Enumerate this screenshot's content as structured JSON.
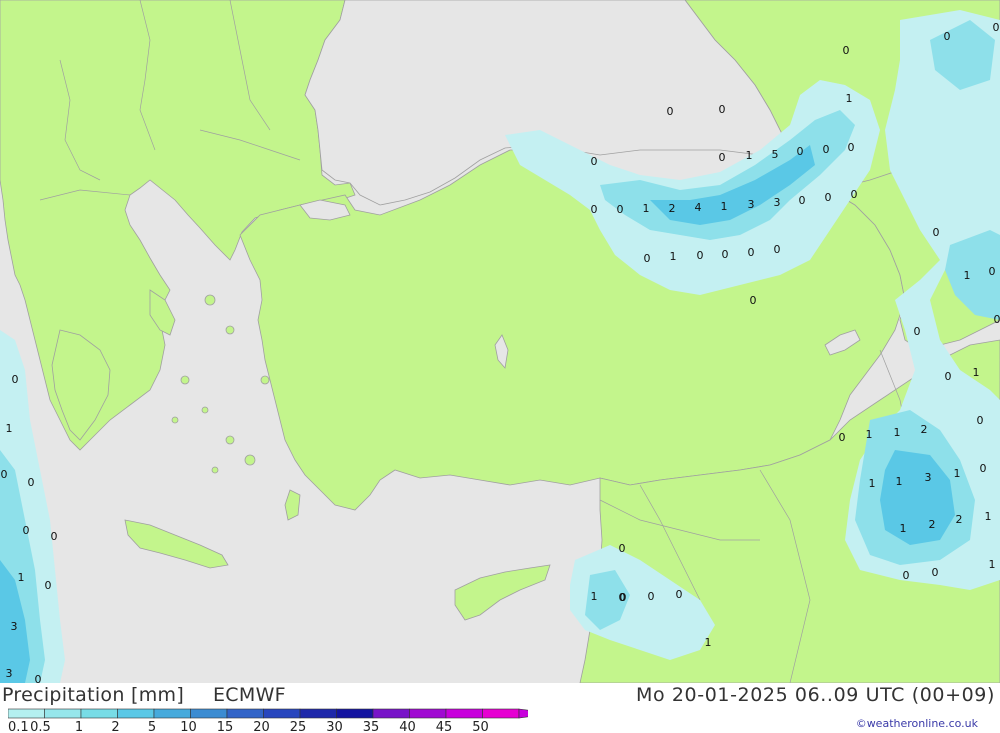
{
  "header": {
    "title": "Precipitation [mm]",
    "model": "ECMWF",
    "valid_time": "Mo 20-01-2025 06..09 UTC (00+09)",
    "credit": "©weatheronline.co.uk"
  },
  "legend": {
    "labels": [
      "0.1",
      "0.5",
      "1",
      "2",
      "5",
      "10",
      "15",
      "20",
      "25",
      "30",
      "35",
      "40",
      "45",
      "50"
    ],
    "colors": [
      "#b4f0f0",
      "#96e6eb",
      "#78dce6",
      "#5ac8e6",
      "#46aadc",
      "#3c8cd2",
      "#3264c8",
      "#2846be",
      "#1e28aa",
      "#1414a0",
      "#7814c8",
      "#a00ad2",
      "#c800dc",
      "#e600d2",
      "#dc00b4",
      "#be00aa"
    ]
  },
  "colors": {
    "land": "#c3f58c",
    "sea": "#e6e6e6",
    "border": "#a0a0a0",
    "precip_light": "#c4f0f2",
    "precip_mid": "#8ee0ea",
    "precip_heavy": "#5ac8e6"
  },
  "map_values": [
    {
      "v": "0"
    },
    {
      "v": "0"
    },
    {
      "v": "0"
    },
    {
      "v": "1"
    },
    {
      "v": "0"
    },
    {
      "v": "0"
    },
    {
      "v": "0"
    },
    {
      "v": "0"
    },
    {
      "v": "1"
    },
    {
      "v": "5"
    },
    {
      "v": "0"
    },
    {
      "v": "0"
    },
    {
      "v": "0"
    },
    {
      "v": "0"
    },
    {
      "v": "0"
    },
    {
      "v": "1"
    },
    {
      "v": "2"
    },
    {
      "v": "4"
    },
    {
      "v": "1"
    },
    {
      "v": "3"
    },
    {
      "v": "3"
    },
    {
      "v": "0"
    },
    {
      "v": "0"
    },
    {
      "v": "0"
    },
    {
      "v": "0"
    },
    {
      "v": "1"
    },
    {
      "v": "0"
    },
    {
      "v": "0"
    },
    {
      "v": "0"
    },
    {
      "v": "0"
    },
    {
      "v": "0"
    },
    {
      "v": "0"
    },
    {
      "v": "0"
    },
    {
      "v": "1"
    },
    {
      "v": "0"
    },
    {
      "v": "0"
    },
    {
      "v": "0"
    },
    {
      "v": "0"
    },
    {
      "v": "1"
    },
    {
      "v": "0"
    },
    {
      "v": "0"
    },
    {
      "v": "1"
    },
    {
      "v": "1"
    },
    {
      "v": "2"
    },
    {
      "v": "1"
    },
    {
      "v": "0"
    },
    {
      "v": "1"
    },
    {
      "v": "1"
    },
    {
      "v": "3"
    },
    {
      "v": "1"
    },
    {
      "v": "0"
    },
    {
      "v": "1"
    },
    {
      "v": "2"
    },
    {
      "v": "2"
    },
    {
      "v": "1"
    },
    {
      "v": "0"
    },
    {
      "v": "0"
    },
    {
      "v": "0"
    },
    {
      "v": "1"
    },
    {
      "v": "0"
    },
    {
      "v": "1"
    },
    {
      "v": "0"
    },
    {
      "v": "0"
    },
    {
      "v": "0"
    },
    {
      "v": "1"
    },
    {
      "v": "0"
    },
    {
      "v": "0"
    },
    {
      "v": "0"
    },
    {
      "v": "1"
    },
    {
      "v": "0"
    },
    {
      "v": "3"
    },
    {
      "v": "3"
    },
    {
      "v": "0"
    }
  ]
}
